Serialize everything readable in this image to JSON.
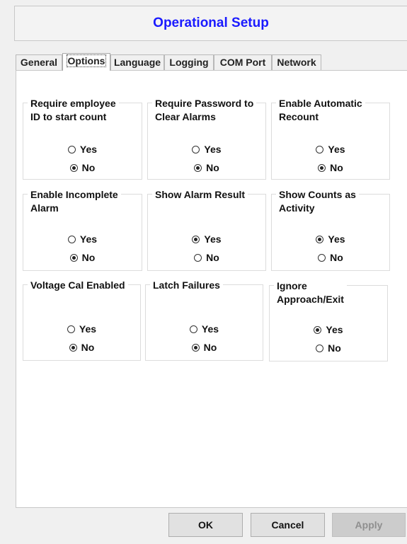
{
  "window": {
    "title": "Operational Setup"
  },
  "tabs": [
    {
      "label": "General",
      "active": false
    },
    {
      "label": "Options",
      "active": true
    },
    {
      "label": "Language",
      "active": false
    },
    {
      "label": "Logging",
      "active": false
    },
    {
      "label": "COM Port",
      "active": false
    },
    {
      "label": "Network",
      "active": false
    }
  ],
  "groups": [
    {
      "label": "Require employee\nID to start count",
      "yes_label": "Yes",
      "no_label": "No",
      "selected": "No"
    },
    {
      "label": "Require Password to\nClear Alarms",
      "yes_label": "Yes",
      "no_label": "No",
      "selected": "No"
    },
    {
      "label": "Enable Automatic\nRecount",
      "yes_label": "Yes",
      "no_label": "No",
      "selected": "No"
    },
    {
      "label": "Enable Incomplete\nAlarm",
      "yes_label": "Yes",
      "no_label": "No",
      "selected": "No"
    },
    {
      "label": "Show Alarm Result",
      "yes_label": "Yes",
      "no_label": "No",
      "selected": "Yes"
    },
    {
      "label": "Show Counts as\nActivity",
      "yes_label": "Yes",
      "no_label": "No",
      "selected": "Yes"
    },
    {
      "label": "Voltage Cal Enabled",
      "yes_label": "Yes",
      "no_label": "No",
      "selected": "No"
    },
    {
      "label": "Latch Failures",
      "yes_label": "Yes",
      "no_label": "No",
      "selected": "No"
    },
    {
      "label": "Ignore\nApproach/Exit",
      "yes_label": "Yes",
      "no_label": "No",
      "selected": "Yes"
    }
  ],
  "buttons": {
    "ok": "OK",
    "cancel": "Cancel",
    "apply": "Apply",
    "apply_enabled": false
  }
}
